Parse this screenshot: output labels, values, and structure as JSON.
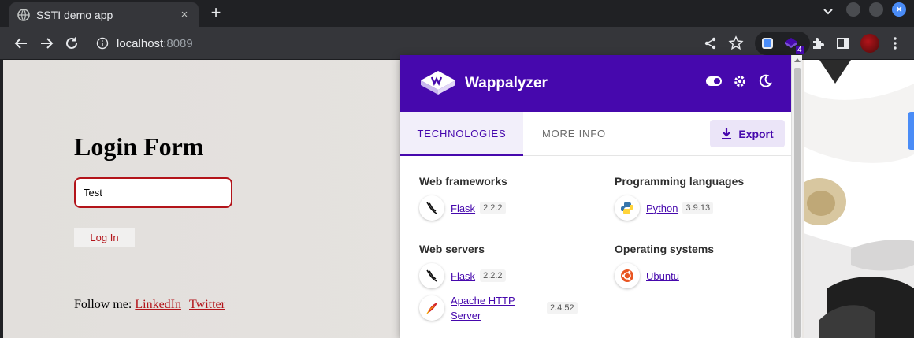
{
  "browser": {
    "tab_title": "SSTI demo app",
    "tab_close": "×",
    "new_tab": "+",
    "url_host": "localhost",
    "url_port": ":8089",
    "extension_badge": "4",
    "accent_color": "#4a8cf7"
  },
  "page": {
    "title": "Login Form",
    "input_value": "Test",
    "login_button": "Log In",
    "follow_label": "Follow me:",
    "links": [
      "LinkedIn",
      "Twitter"
    ],
    "accent_color": "#b3141a"
  },
  "wappalyzer": {
    "brand": "Wappalyzer",
    "brand_color": "#4608ad",
    "tabs": [
      "TECHNOLOGIES",
      "MORE INFO"
    ],
    "export_label": "Export",
    "categories": [
      {
        "name": "Web frameworks",
        "items": [
          {
            "name": "Flask",
            "version": "2.2.2",
            "icon": "flask-icon"
          }
        ]
      },
      {
        "name": "Programming languages",
        "items": [
          {
            "name": "Python",
            "version": "3.9.13",
            "icon": "python-icon"
          }
        ]
      },
      {
        "name": "Web servers",
        "items": [
          {
            "name": "Flask",
            "version": "2.2.2",
            "icon": "flask-icon"
          },
          {
            "name_line1": "Apache HTTP",
            "name_line2": "Server",
            "version": "2.4.52",
            "icon": "apache-feather-icon"
          }
        ]
      },
      {
        "name": "Operating systems",
        "items": [
          {
            "name": "Ubuntu",
            "icon": "ubuntu-icon"
          }
        ]
      }
    ]
  }
}
